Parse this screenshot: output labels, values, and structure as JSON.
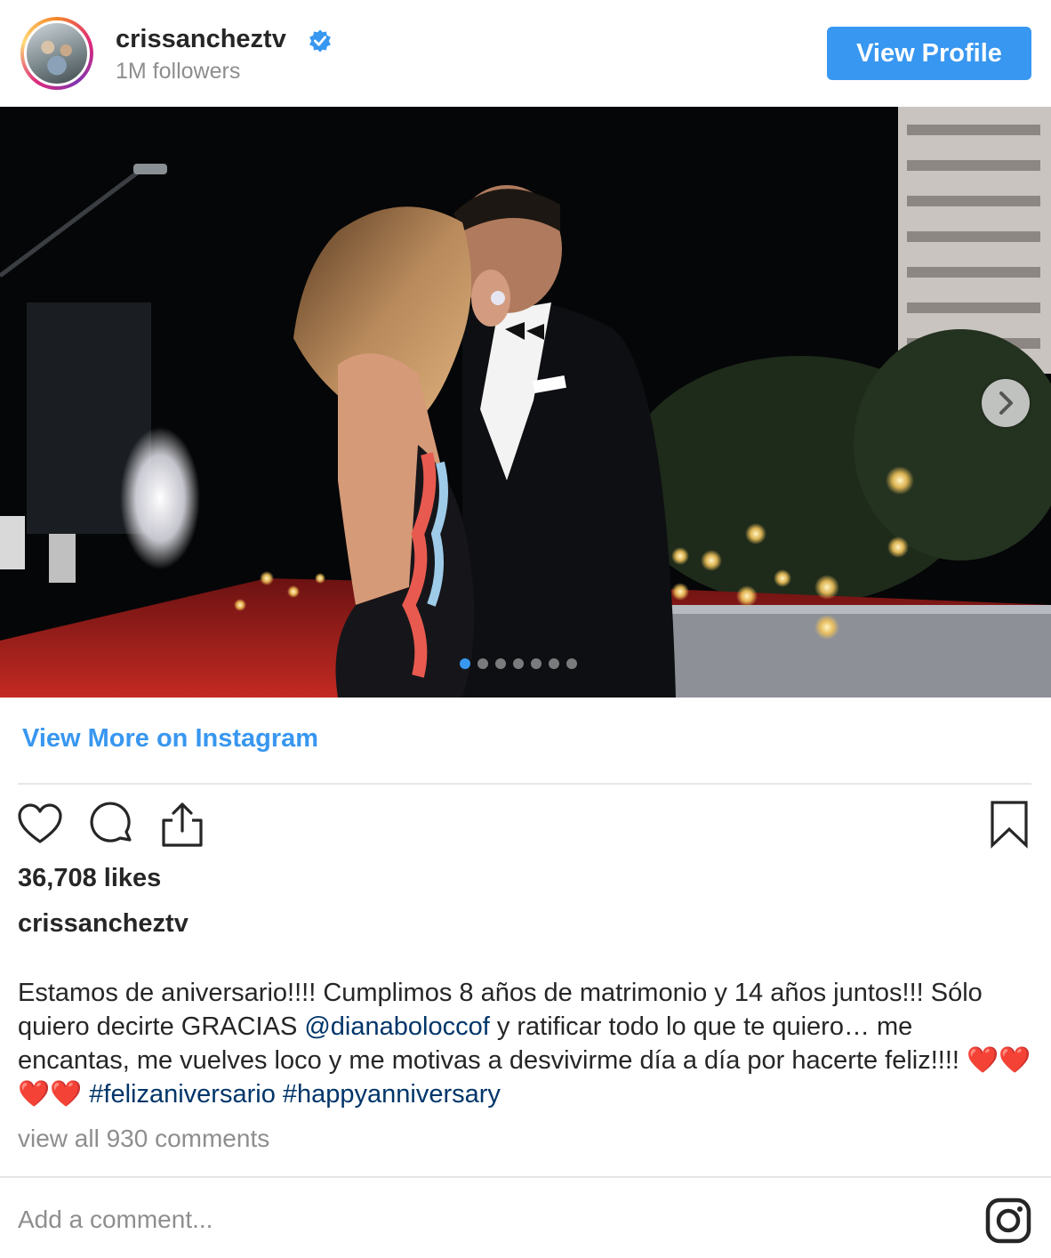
{
  "header": {
    "username": "crissancheztv",
    "followers": "1M followers",
    "view_profile_label": "View Profile"
  },
  "post": {
    "carousel": {
      "total_slides": 7,
      "active_slide": 1
    },
    "view_more_label": "View More on Instagram",
    "likes": "36,708 likes",
    "caption_user": "crissancheztv",
    "caption": {
      "text_1": "Estamos de aniversario!!!! Cumplimos 8 años de matrimonio y 14 años juntos!!! Sólo quiero decirte GRACIAS ",
      "mention": "@dianaboloccof",
      "text_2": " y ratificar todo lo que te quiero… me encantas, me vuelves loco y me motivas a desvivirme día a día por hacerte feliz!!!! ",
      "hearts": "❤️❤️❤️❤️",
      "hashtag_1": "#felizaniversario",
      "hashtag_2": "#happyanniversary"
    },
    "view_comments": "view all 930 comments",
    "comment_placeholder": "Add a comment..."
  },
  "icons": {
    "verified": "verified-badge-icon",
    "like": "heart-icon",
    "comment": "comment-bubble-icon",
    "share": "share-icon",
    "save": "bookmark-icon",
    "next": "chevron-right-icon",
    "instagram": "instagram-logo-icon"
  },
  "colors": {
    "accent": "#3897f0",
    "link": "#003569",
    "muted": "#8e8e8e",
    "text": "#262626"
  }
}
